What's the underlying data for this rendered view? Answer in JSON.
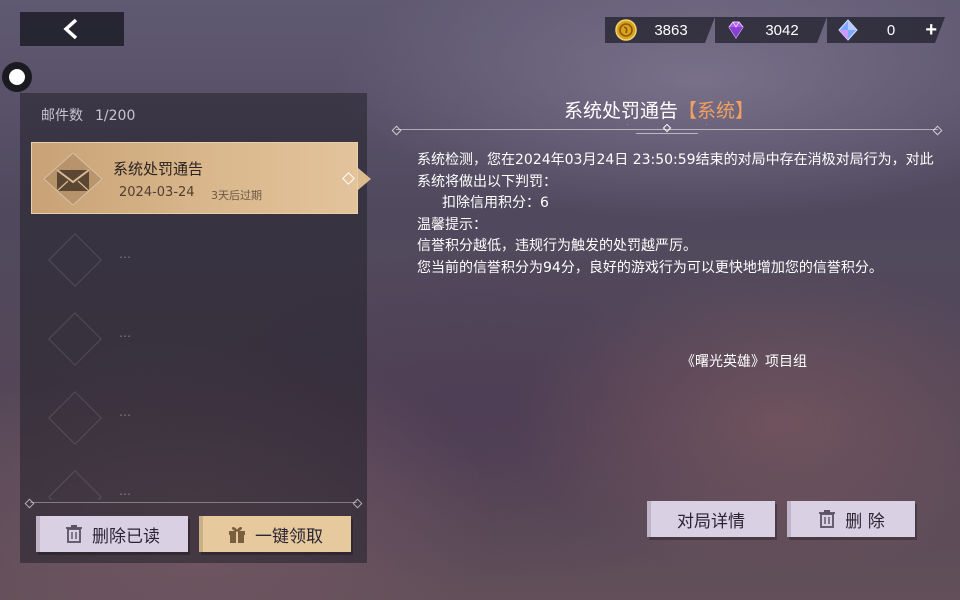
{
  "currency": {
    "gold": {
      "icon": "gold-coin-icon",
      "value": "3863"
    },
    "diamond": {
      "icon": "purple-diamond-icon",
      "value": "3042"
    },
    "crystal": {
      "icon": "blue-crystal-icon",
      "value": "0",
      "add_label": "+"
    }
  },
  "mail_list": {
    "count_label": "邮件数",
    "count_value": "1/200",
    "items": [
      {
        "title": "系统处罚通告",
        "date": "2024-03-24",
        "expire": "3天后过期",
        "icon": "envelope-icon"
      }
    ],
    "placeholder_dots": "…"
  },
  "buttons": {
    "delete_read": "删除已读",
    "claim_all": "一键领取",
    "match_detail": "对局详情",
    "delete": "删 除"
  },
  "detail": {
    "title": "系统处罚通告",
    "tag": "【系统】",
    "lines": [
      "系统检测，您在2024年03月24日 23:50:59结束的对局中存在消极对局行为，对此系统将做出以下判罚：",
      "扣除信用积分：6",
      "温馨提示：",
      "信誉积分越低，违规行为触发的处罚越严厉。",
      "您当前的信誉积分为94分，良好的游戏行为可以更快地增加您的信誉积分。"
    ],
    "signature": "《曙光英雄》项目组"
  },
  "colors": {
    "accent_gold": "#dbb98e",
    "tag_orange": "#f0a060",
    "button_lilac": "#d9d0e4"
  }
}
